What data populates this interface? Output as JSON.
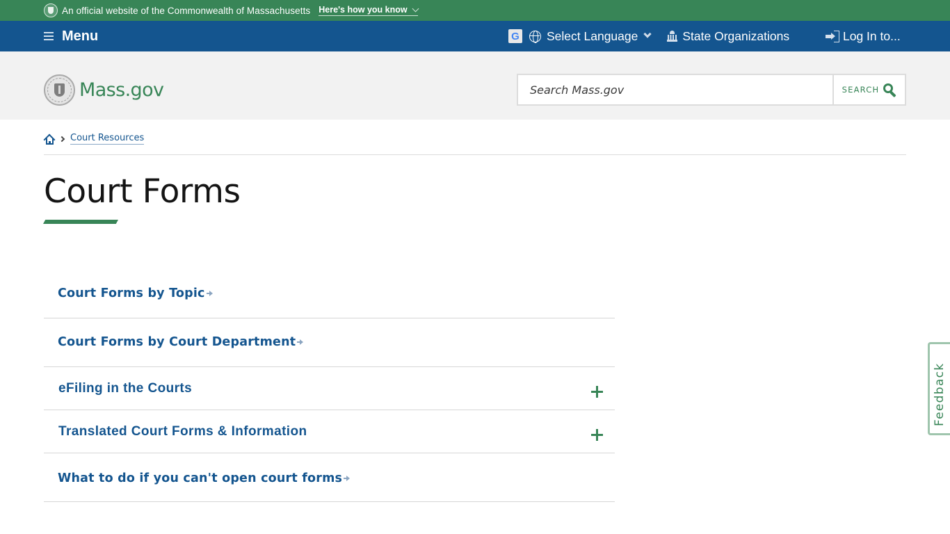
{
  "official_banner": {
    "text": "An official website of the Commonwealth of Massachusetts",
    "toggle_label": "Here's how you know",
    "icon": "state-seal-icon"
  },
  "utility_nav": {
    "menu_label": "Menu",
    "language_label": "Select Language",
    "organizations_label": "State Organizations",
    "login_label": "Log In to...",
    "icons": [
      "hamburger-icon",
      "google-translate-icon",
      "globe-icon",
      "chevron-down-icon",
      "capitol-building-icon",
      "login-icon"
    ]
  },
  "header": {
    "logo_text": "Mass.gov",
    "search": {
      "placeholder": "Search Mass.gov",
      "value": "",
      "button_label": "SEARCH"
    }
  },
  "breadcrumb": {
    "items": [
      {
        "label": "Court Resources"
      }
    ]
  },
  "page": {
    "title": "Court Forms"
  },
  "links": [
    {
      "label": "Court Forms by Topic",
      "type": "link"
    },
    {
      "label": "Court Forms by Court Department",
      "type": "link"
    },
    {
      "label": "eFiling in the Courts",
      "type": "accordion",
      "expanded": false
    },
    {
      "label": "Translated Court Forms & Information",
      "type": "accordion",
      "expanded": false
    },
    {
      "label": "What to do if you can't open court forms",
      "type": "link"
    }
  ],
  "feedback": {
    "label": "Feedback"
  },
  "colors": {
    "brand_green": "#388557",
    "nav_blue": "#14558f",
    "header_gray": "#f2f2f2",
    "link_blue": "#14558f"
  }
}
